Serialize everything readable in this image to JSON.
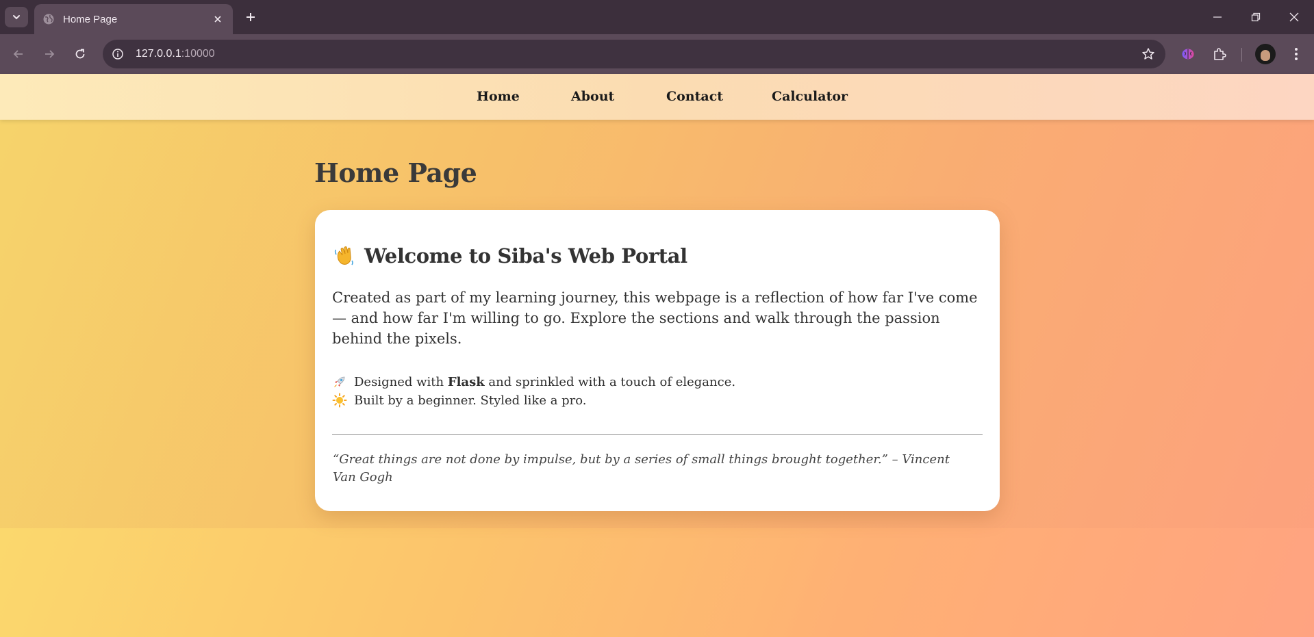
{
  "browser": {
    "tab_title": "Home Page",
    "url_host": "127.0.0.1",
    "url_port": ":10000"
  },
  "nav": {
    "items": [
      {
        "label": "Home"
      },
      {
        "label": "About"
      },
      {
        "label": "Contact"
      },
      {
        "label": "Calculator"
      }
    ]
  },
  "page": {
    "heading": "Home Page"
  },
  "card": {
    "title": "Welcome to Siba's Web Portal",
    "intro": "Created as part of my learning journey, this webpage is a reflection of how far I've come — and how far I'm willing to go. Explore the sections and walk through the passion behind the pixels.",
    "feature1_before": "Designed with ",
    "feature1_bold": "Flask",
    "feature1_after": " and sprinkled with a touch of elegance.",
    "feature2": "Built by a beginner. Styled like a pro.",
    "quote": "“Great things are not done by impulse, but by a series of small things brought together.” – Vincent Van Gogh"
  },
  "icons": {
    "title_icon": "waving-hand-icon",
    "feature1_icon": "rocket-icon",
    "feature2_icon": "sun-icon"
  },
  "colors": {
    "gradient_start": "#f6d46b",
    "gradient_end": "#fda07e",
    "card_bg": "#ffffff",
    "browser_frame": "#3c2f3c"
  }
}
